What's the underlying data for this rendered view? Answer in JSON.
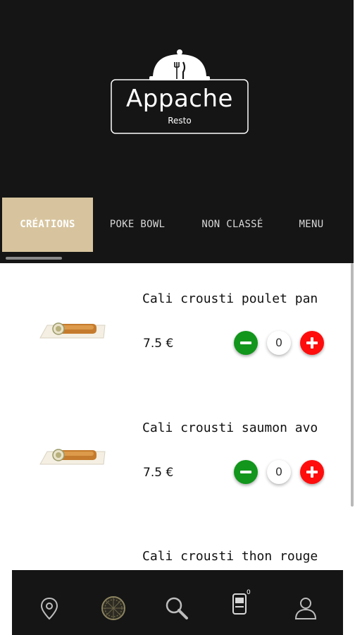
{
  "brand": {
    "name": "Appache",
    "subtitle": "Resto"
  },
  "tabs": [
    {
      "label": "CRÉATIONS",
      "active": true
    },
    {
      "label": "POKE BOWL",
      "active": false
    },
    {
      "label": "NON CLASSÉ",
      "active": false
    },
    {
      "label": "MENU",
      "active": false
    }
  ],
  "products": [
    {
      "name": "Cali crousti poulet pan",
      "price": "7.5 €",
      "quantity": "0"
    },
    {
      "name": "Cali crousti saumon avo",
      "price": "7.5 €",
      "quantity": "0"
    },
    {
      "name": "Cali crousti thon rouge"
    }
  ],
  "bottom_nav": {
    "items": [
      "location-icon",
      "pizza-icon",
      "search-icon",
      "cart-icon",
      "user-icon"
    ],
    "cart_count": "0"
  },
  "colors": {
    "header_bg": "#151515",
    "active_tab": "#d7c49e",
    "minus_button": "#12961c",
    "plus_button": "#ff0d0d"
  }
}
